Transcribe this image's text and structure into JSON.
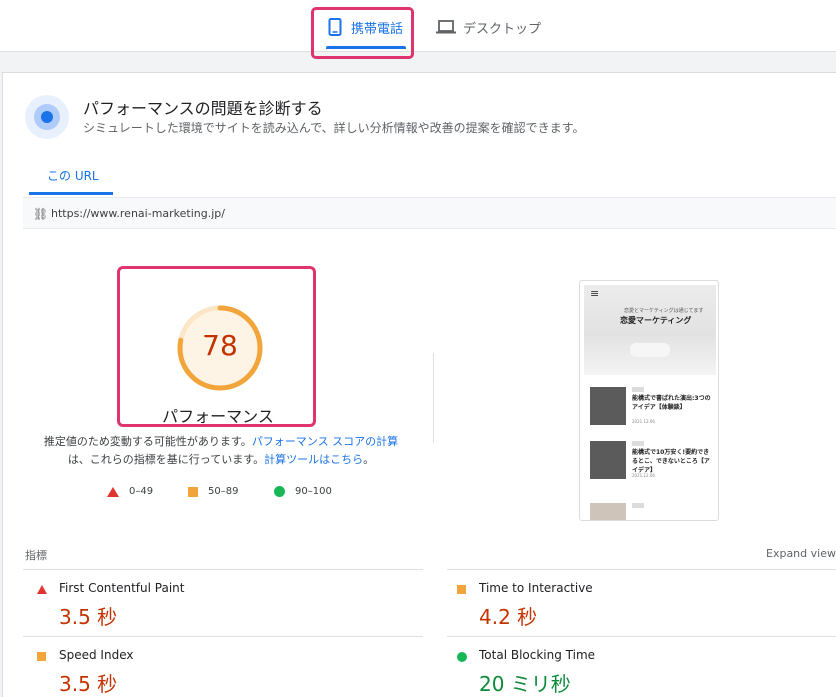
{
  "device_tabs": {
    "mobile": {
      "label": "携帯電話",
      "selected": true
    },
    "desktop": {
      "label": "デスクトップ",
      "selected": false
    }
  },
  "diagnose": {
    "title": "パフォーマンスの問題を診断する",
    "subtitle": "シミュレートした環境でサイトを読み込んで、詳しい分析情報や改善の提案を確認できます。"
  },
  "url_tab": {
    "label": "この URL"
  },
  "url_bar": {
    "url": "https://www.renai-marketing.jp/"
  },
  "score": {
    "value": "78",
    "fraction": 0.78,
    "label": "パフォーマンス",
    "color": "#f2a53b"
  },
  "note": {
    "part1": "推定値のため変動する可能性があります。",
    "link1": "パフォーマンス スコアの計算",
    "part2": "は、これらの指標を基に行っています。",
    "link2": "計算ツールはこちら",
    "part3": "。"
  },
  "legend": [
    {
      "shape": "triangle",
      "range": "0–49",
      "color": "#e0342f"
    },
    {
      "shape": "square",
      "range": "50–89",
      "color": "#f2a53b"
    },
    {
      "shape": "circle",
      "range": "90–100",
      "color": "#16b856"
    }
  ],
  "preview": {
    "site_subtitle": "恋愛とマーケティングは通じてます",
    "site_name": "恋愛マーケティング",
    "posts": [
      {
        "title": "能構式で書ばれた演出:3つのアイデア【体験談】",
        "meta": "2021.12.06"
      },
      {
        "title": "能構式で10万安く!要約できるとこ、できないところ【アイデア】",
        "meta": "2021.12.06"
      },
      {
        "title": "",
        "meta": ""
      }
    ]
  },
  "metrics": {
    "heading": "指標",
    "expand_label": "Expand view",
    "items": [
      {
        "name": "First Contentful Paint",
        "value": "3.5 秒",
        "status": "poor"
      },
      {
        "name": "Time to Interactive",
        "value": "4.2 秒",
        "status": "average"
      },
      {
        "name": "Speed Index",
        "value": "3.5 秒",
        "status": "average"
      },
      {
        "name": "Total Blocking Time",
        "value": "20 ミリ秒",
        "status": "good"
      }
    ]
  }
}
